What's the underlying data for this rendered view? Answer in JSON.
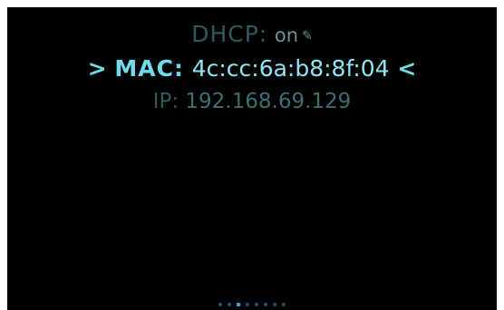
{
  "network": {
    "dhcp": {
      "label": "DHCP:",
      "value": "on",
      "edit_icon": "pencil-icon"
    },
    "mac": {
      "prefix": ">",
      "label": "MAC:",
      "value": "4c:cc:6a:b8:8f:04",
      "suffix": "<"
    },
    "ip": {
      "label": "IP:",
      "value": "192.168.69.129"
    }
  },
  "pager": {
    "count": 8,
    "active_index": 2
  },
  "colors": {
    "background": "#000000",
    "selected_text": "#6fdcec",
    "dim_text": "#2f5a5d",
    "pager_active": "#3fa8d8",
    "pager_inactive": "#1e4a66"
  }
}
